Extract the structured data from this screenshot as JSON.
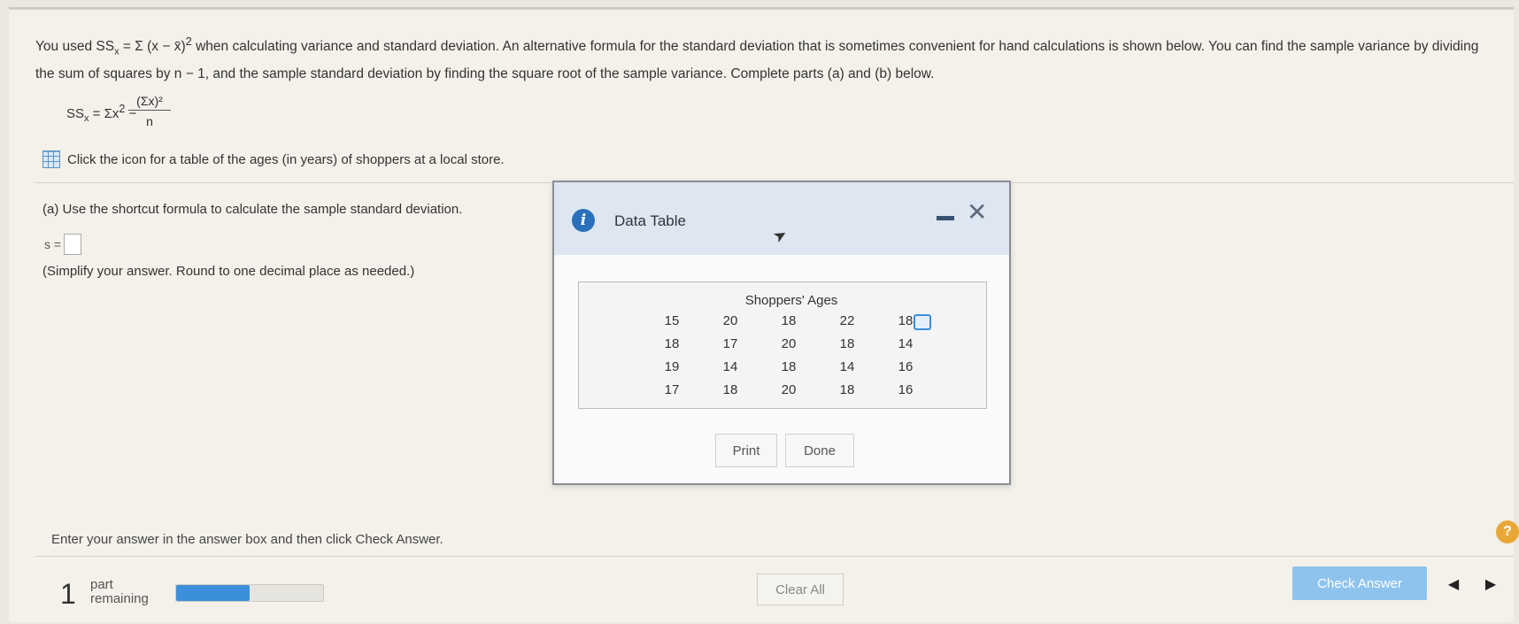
{
  "question": {
    "intro_prefix": "You used SS",
    "intro_sub": "x",
    "intro_formula": " = Σ (x − x̄)",
    "intro_sup": "2",
    "intro_rest": " when calculating variance and standard deviation. An alternative formula for the standard deviation that is sometimes convenient for hand calculations is shown below. You can find the sample variance by dividing the sum of squares by n − 1, and the sample standard deviation by finding the square root of the sample variance. Complete parts (a) and (b) below."
  },
  "formula": {
    "left": "SS",
    "sub": "x",
    "mid": " = Σx",
    "sup": "2",
    "minus": " −",
    "numerator": "(Σx)²",
    "denominator": "n"
  },
  "table_link": "Click the icon for a table of the ages (in years) of shoppers at a local store.",
  "part_a": {
    "prompt": "(a) Use the shortcut formula to calculate the sample standard deviation.",
    "answer_label": "s =",
    "hint": "(Simplify your answer. Round to one decimal place as needed.)"
  },
  "modal": {
    "title": "Data Table",
    "caption": "Shoppers' Ages",
    "rows": [
      [
        "15",
        "20",
        "18",
        "22",
        "18"
      ],
      [
        "18",
        "17",
        "20",
        "18",
        "14"
      ],
      [
        "19",
        "14",
        "18",
        "14",
        "16"
      ],
      [
        "17",
        "18",
        "20",
        "18",
        "16"
      ]
    ],
    "print_label": "Print",
    "done_label": "Done"
  },
  "footer": {
    "instruction": "Enter your answer in the answer box and then click Check Answer.",
    "help": "?",
    "part_count": "1",
    "part_label_1": "part",
    "part_label_2": "remaining",
    "progress_fraction": 0.5,
    "clear_label": "Clear All",
    "check_label": "Check Answer",
    "prev": "◀",
    "next": "▶"
  }
}
